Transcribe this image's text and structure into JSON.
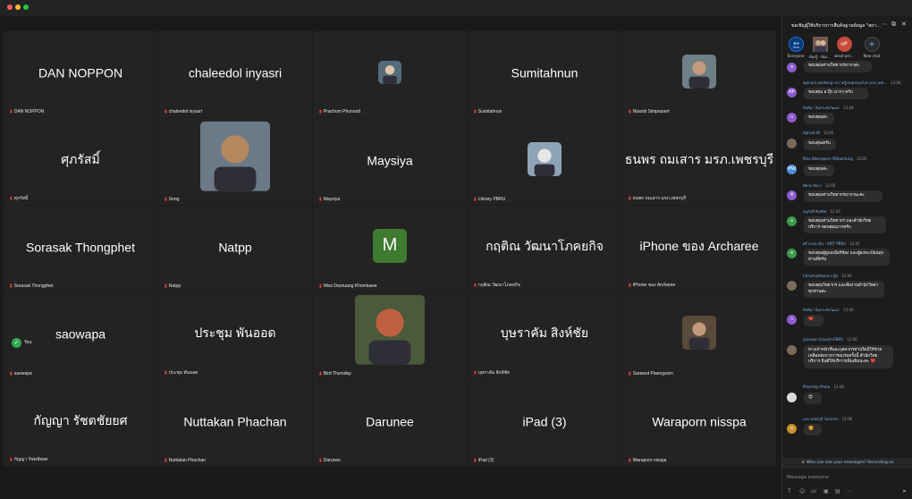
{
  "gallery": {
    "tiles": [
      {
        "name": "DAN NOPPON",
        "label": "DAN NOPPON"
      },
      {
        "name": "chaleedol inyasri",
        "label": "chaleedol inyasri"
      },
      {
        "name": "",
        "label": "Prachum Phunood"
      },
      {
        "name": "Sumitahnun",
        "label": "Sumitahnun"
      },
      {
        "name": "",
        "label": "Nisanti Simprasert"
      },
      {
        "name": "ศุภรัสมิ์",
        "label": "ศุภรัสมิ์"
      },
      {
        "name": "",
        "label": "Song"
      },
      {
        "name": "Maysiya",
        "label": "Maysiya"
      },
      {
        "name": "",
        "label": "Library PBRU"
      },
      {
        "name": "ธนพร ถมเสาร มรภ.เพชรบุรี",
        "label": "ธนพร ถมเสาร มรภ.เพชรบุรี"
      },
      {
        "name": "Sorasak Thongphet",
        "label": "Sorasak Thongphet"
      },
      {
        "name": "Natpp",
        "label": "Natpp"
      },
      {
        "name": "",
        "label": "Miss Daoruang Khomkaew"
      },
      {
        "name": "กฤติณ วัฒนาโภคยกิจ",
        "label": "กฤติณ วัฒนาโภคยกิจ"
      },
      {
        "name": "iPhone ของ Archaree",
        "label": "iPhone ของ Archaree"
      },
      {
        "name": "saowapa",
        "label": "saowapa"
      },
      {
        "name": "ประชุม พันออด",
        "label": "ประชุม พันออด"
      },
      {
        "name": "",
        "label": "Bird Thursday"
      },
      {
        "name": "บุษราคัม สิงห์ชัย",
        "label": "บุษราคัม สิงห์ชัย"
      },
      {
        "name": "",
        "label": "Sarawut Plaengsorn"
      },
      {
        "name": "กัญญา รัชตชัยยศ",
        "label": "กัญญา รัชตชัยยศ"
      },
      {
        "name": "Nuttakan Phachan",
        "label": "Nuttakan Phachan"
      },
      {
        "name": "Darunee",
        "label": "Darunee"
      },
      {
        "name": "iPad (3)",
        "label": "iPad (3)"
      },
      {
        "name": "Waraporn nisspa",
        "label": "Waraporn nisspa"
      }
    ],
    "avatar_letter": "M",
    "you_label": "You"
  },
  "chat": {
    "title": "ขอเชิญผู้ใช้บริการการสืบค้นฐานข้อมูล \"สถาบ...",
    "tabs": [
      {
        "label": "Everyone"
      },
      {
        "label": "ห้องรู้ - ห้อง..."
      },
      {
        "label": "wisat per..."
      },
      {
        "label": "New chat"
      }
    ],
    "messages": [
      {
        "author": "",
        "time": "",
        "text": "ขอบคุณท่านวิทยากรมากๆค่ะ",
        "initial": "ฮ",
        "color": "#8e5bd0"
      },
      {
        "author": "apinant pantong~ความรู้เกษตรมองโลก.มรภ.เพช...",
        "time": "12:04",
        "text": "ขอบคุณ อ.ปุ๊ก มากๆ ครับ",
        "initial": "AP",
        "color": "#8e5bd0"
      },
      {
        "author": "กิตติมา ฉิมกระทั่งวัฒนา",
        "time": "12:04",
        "text": "ขอบคุณค่ะ",
        "initial": "ก",
        "color": "#8e5bd0"
      },
      {
        "author": "Aphisit.W",
        "time": "12:05",
        "text": "ขอบคุณครับ",
        "initial": "",
        "color": "#7a6a5a"
      },
      {
        "author": "Miss Weeraporn Wilbantung",
        "time": "12:05",
        "text": "ขอบคุณค่ะ",
        "initial": "MW",
        "color": "#4a8fd8"
      },
      {
        "author": "ทิพวด ลือฤา",
        "time": "12:05",
        "text": "ขอบคุณท่านวิทยากรมากๆนะคะ",
        "initial": "ทั",
        "color": "#8e5bd0"
      },
      {
        "author": "อนุภักดี สิงห์ทัพ",
        "time": "12:05",
        "text": "ขอบคุณท่านวิทยากร และสำนักวิทยบริการ ขอบคุณมากครับ",
        "initial": "อ",
        "color": "#3d9a4a"
      },
      {
        "author": "ศรี เกรณาจีน - ARIT PBRU",
        "time": "12:05",
        "text": "ขอบคุณผู้ดูแลเบียร์ห้อง และผู้ลงทะเบียนทุกท่านที่ครับ",
        "initial": "ศ",
        "color": "#3d9a4a"
      },
      {
        "author": "Chinchuthamo-ร ผู้ช",
        "time": "12:06",
        "text": "ขอบคุณวิทยากร และทีมงานสำนักวิทยาทุกท่านค่ะ",
        "initial": "",
        "color": "#7a6a5a"
      },
      {
        "author": "กิตติมา ฉิมกระทั่งวัฒนา",
        "time": "12:06",
        "text": "❤️",
        "initial": "ก",
        "color": "#8e5bd0"
      },
      {
        "author": "piyawan khuaim-PBRU",
        "time": "12:06",
        "text": "ทางเจ้าหน้าที่และบุคลากรท่านใดมีให้ช่วยเหลือหลังจากการอบรมครั้งนี้ สำนักวิทยบริการ ยินดีให้บริการเพิ่มเติมนะคะ ❤️",
        "initial": "",
        "color": "#7a6a5a"
      },
      {
        "author": "Phornhip Pharo",
        "time": "12:06",
        "text": "😍",
        "initial": "",
        "color": "#dddddd"
      },
      {
        "author": "มรภ.เพชรบุรี โดยกรจร",
        "time": "12:06",
        "text": "🥰",
        "initial": "ม",
        "color": "#c9902a"
      }
    ],
    "disclaimer": "Who can see your messages? Recording on",
    "compose_placeholder": "Message everyone"
  },
  "colors": {
    "accent": "#0e72ed",
    "mic_muted": "#e0433a",
    "avatar_green": "#3e7a2f"
  }
}
